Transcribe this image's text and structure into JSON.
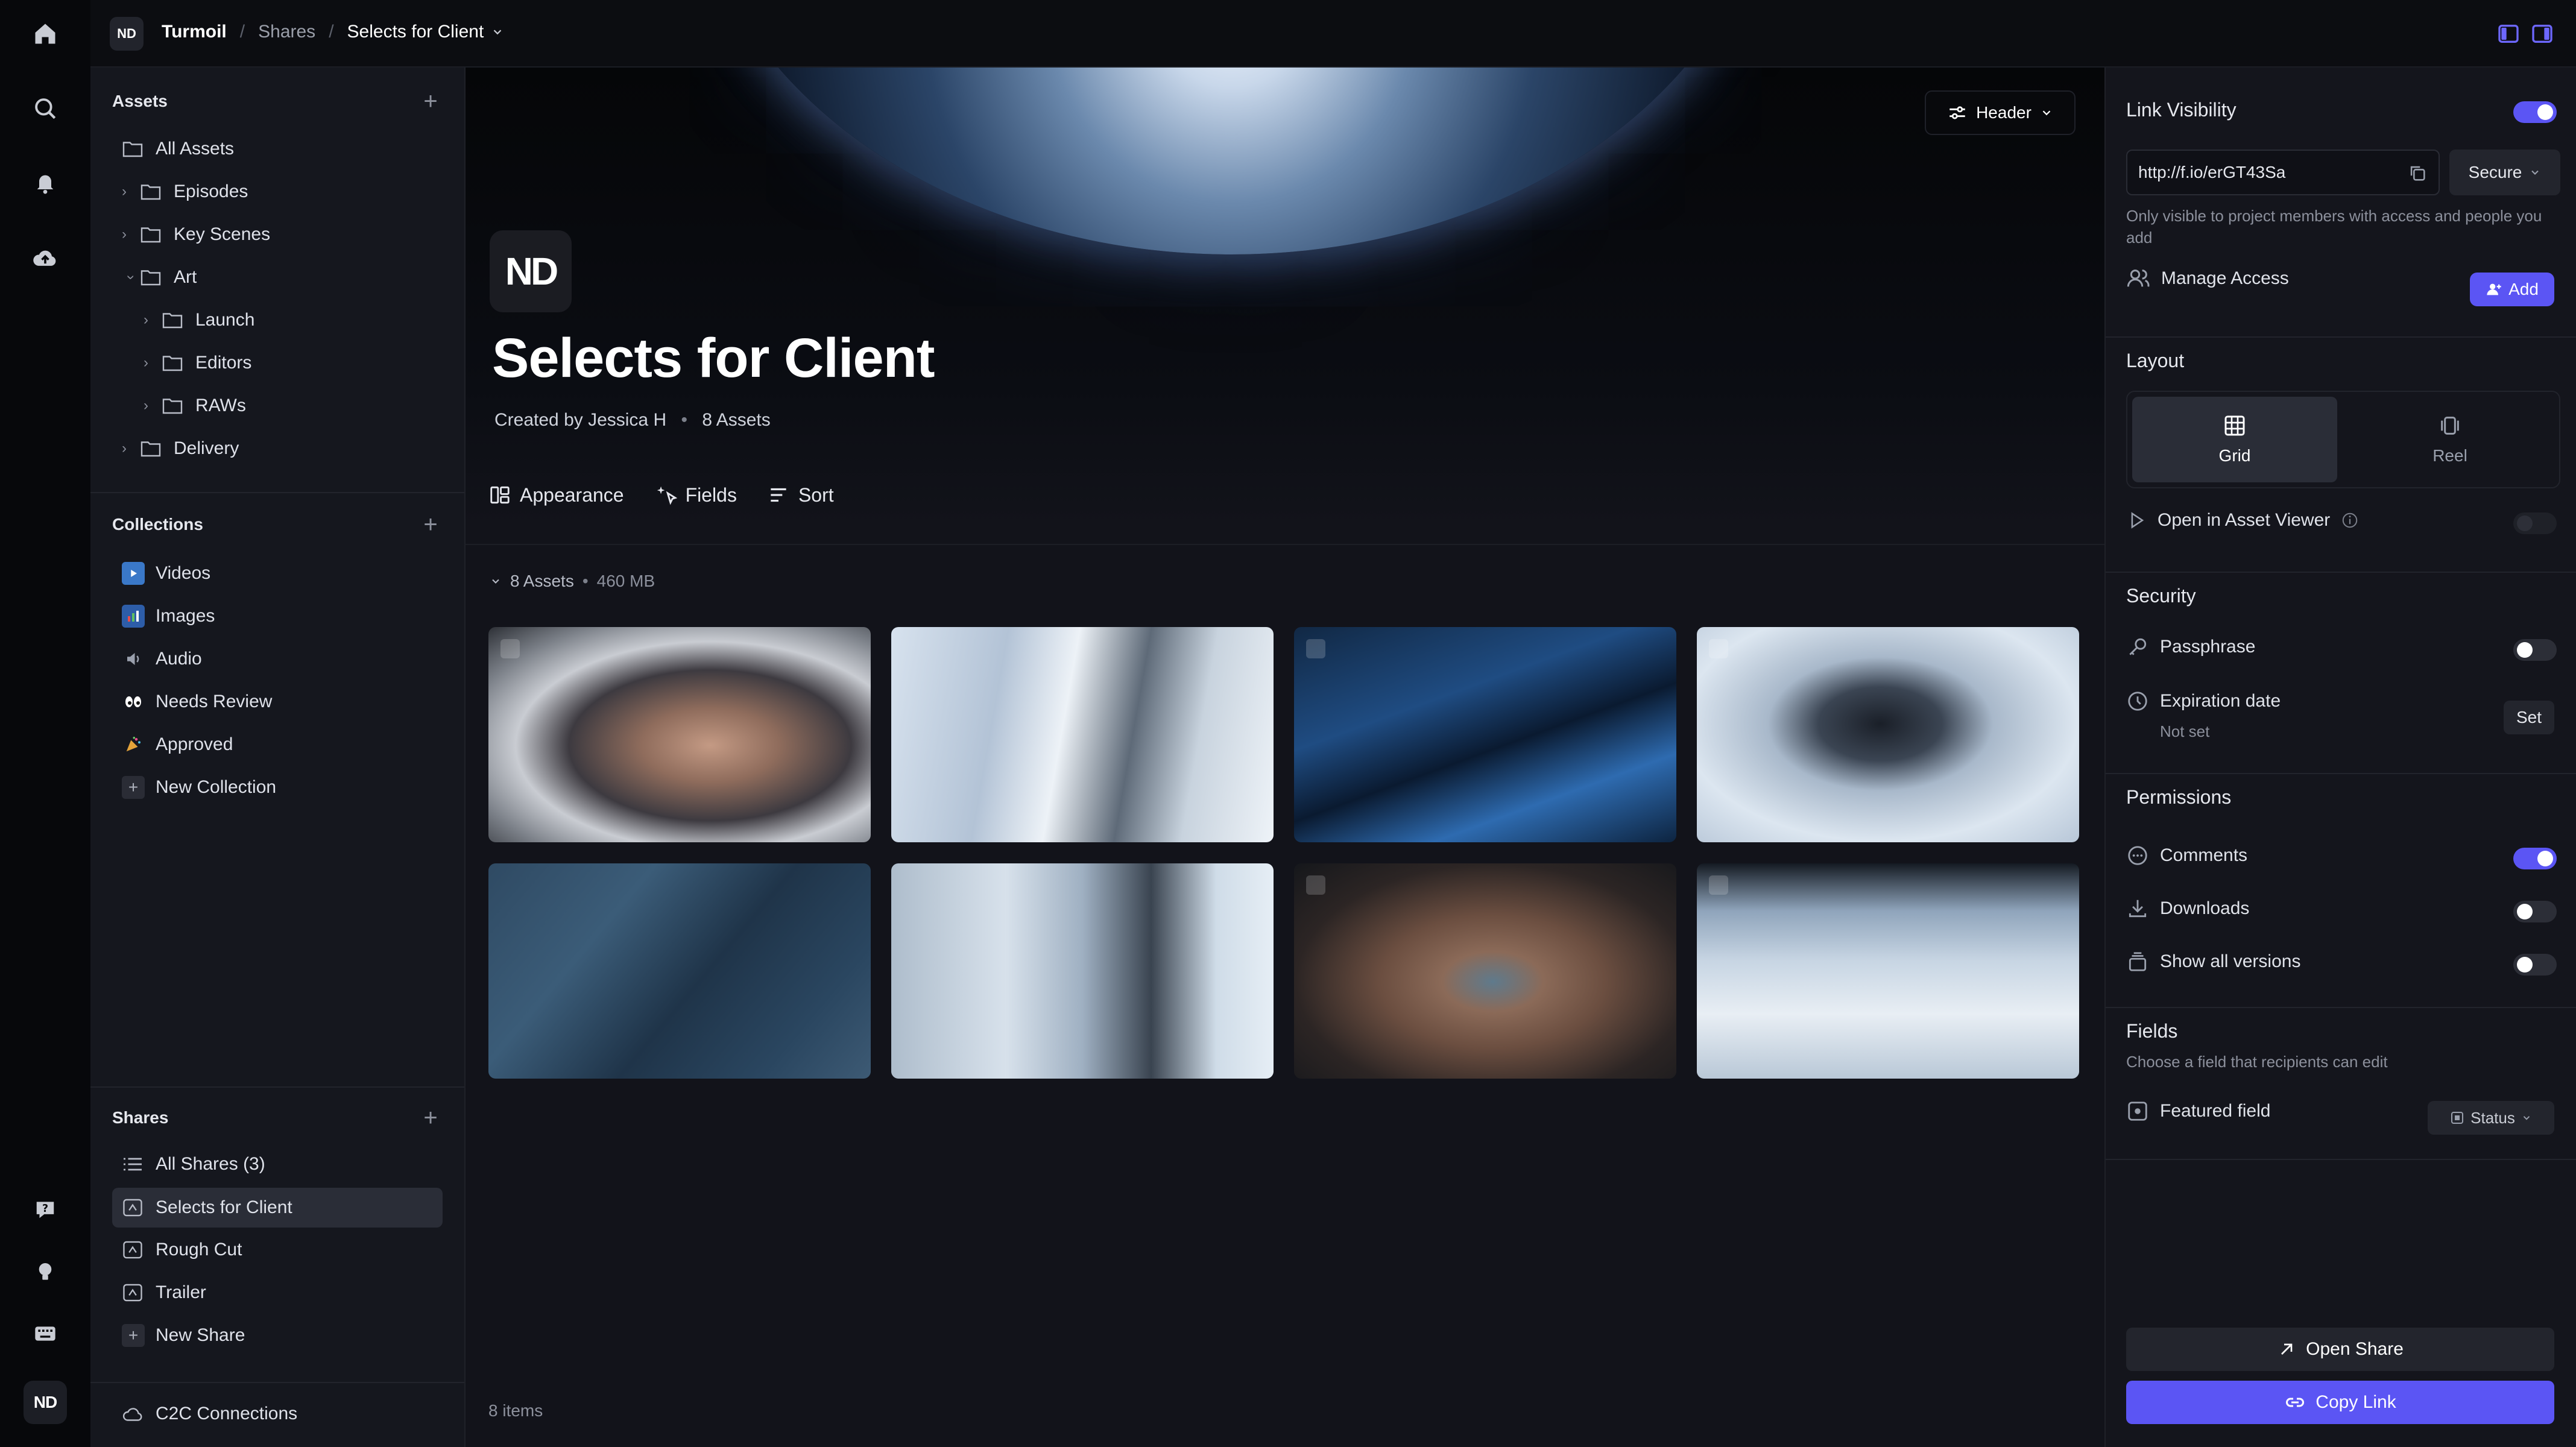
{
  "topbar": {
    "workspace_logo": "ND",
    "crumbs": [
      "Turmoil",
      "Shares",
      "Selects for Client"
    ],
    "right_icons": [
      "left-panel-icon",
      "right-panel-icon"
    ]
  },
  "rail": {
    "icons": [
      "home-icon",
      "search-icon",
      "bell-icon",
      "upload-cloud-icon",
      "help-icon",
      "lightbulb-icon",
      "keyboard-icon"
    ],
    "avatar": "ND"
  },
  "sidebar": {
    "assets_title": "Assets",
    "assets_tree": [
      {
        "label": "All Assets"
      },
      {
        "label": "Episodes"
      },
      {
        "label": "Key Scenes"
      },
      {
        "label": "Art"
      },
      {
        "label": "Launch"
      },
      {
        "label": "Editors"
      },
      {
        "label": "RAWs"
      },
      {
        "label": "Delivery"
      }
    ],
    "collections_title": "Collections",
    "collections": [
      {
        "label": "Videos",
        "icon": "video-collection-icon"
      },
      {
        "label": "Images",
        "icon": "image-collection-icon"
      },
      {
        "label": "Audio",
        "icon": "speaker-icon"
      },
      {
        "label": "Needs Review",
        "icon": "eyes-icon"
      },
      {
        "label": "Approved",
        "icon": "party-popper-icon"
      },
      {
        "label": "New Collection",
        "icon": "plus-icon"
      }
    ],
    "shares_title": "Shares",
    "shares": [
      {
        "label": "All Shares (3)"
      },
      {
        "label": "Selects for Client"
      },
      {
        "label": "Rough Cut"
      },
      {
        "label": "Trailer"
      },
      {
        "label": "New Share"
      }
    ],
    "c2c": "C2C Connections"
  },
  "main": {
    "header_button": "Header",
    "logo": "ND",
    "title": "Selects for Client",
    "created_by": "Created by Jessica H",
    "asset_count": "8 Assets",
    "toolbar": [
      "Appearance",
      "Fields",
      "Sort"
    ],
    "group_label": "8 Assets",
    "group_size": "460 MB",
    "items_count": "8 items"
  },
  "right_panel": {
    "link_visibility": "Link Visibility",
    "link_url": "http://f.io/erGT43Sa",
    "security_select": "Secure",
    "visibility_note": "Only visible to project members with access and people you add",
    "manage_access": "Manage Access",
    "add_button": "Add",
    "layout_title": "Layout",
    "layout_grid": "Grid",
    "layout_reel": "Reel",
    "open_in_viewer": "Open in Asset Viewer",
    "security_title": "Security",
    "passphrase": "Passphrase",
    "expiration": "Expiration date",
    "expiration_value": "Not set",
    "set_button": "Set",
    "permissions_title": "Permissions",
    "comments": "Comments",
    "downloads": "Downloads",
    "show_versions": "Show all versions",
    "fields_title": "Fields",
    "fields_note": "Choose a field that recipients can edit",
    "featured_field": "Featured field",
    "featured_value": "Status",
    "open_share": "Open Share",
    "copy_link": "Copy Link"
  },
  "colors": {
    "accent": "#5b55f4",
    "background": "#12131a",
    "panel": "#14151c"
  }
}
